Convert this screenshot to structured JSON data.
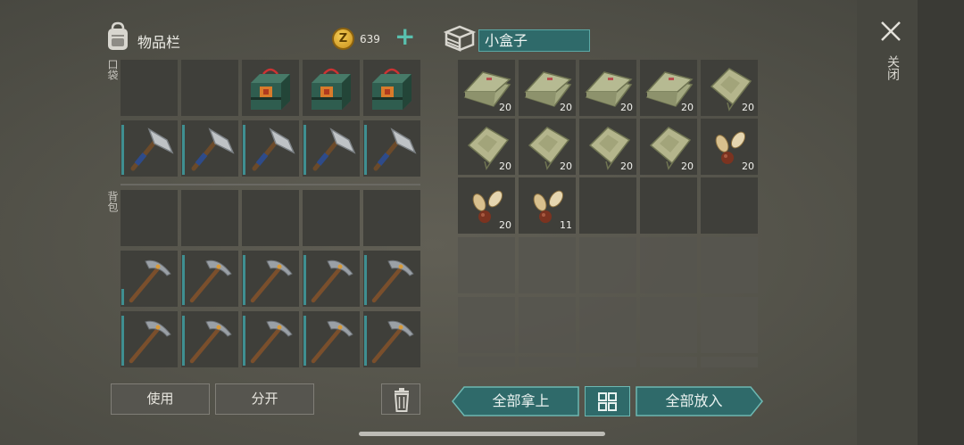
{
  "inventory": {
    "title": "物品栏",
    "coins": "639",
    "add_label": "+",
    "pocket_label": "口袋",
    "backpack_label": "背包",
    "use_label": "使用",
    "split_label": "分开"
  },
  "container": {
    "name": "小盒子",
    "take_all_label": "全部拿上",
    "put_all_label": "全部放入",
    "items_qty": [
      "20",
      "20",
      "20",
      "20",
      "20",
      "20",
      "20",
      "20",
      "20",
      "20",
      "20",
      "11"
    ]
  },
  "close_label": "关闭",
  "coin_symbol": "Z",
  "icons": [
    "backpack-icon",
    "coin-icon",
    "crate-icon",
    "trash-icon",
    "grid-icon",
    "close-icon",
    "toolbox-icon",
    "hatchet-icon",
    "pickaxe-icon",
    "cloth-stack-icon",
    "cloth-piece-icon",
    "seeds-icon"
  ],
  "colors": {
    "accent": "#59c0ae",
    "teal_panel": "#2f6a6a",
    "durability": "#3f8f91"
  }
}
